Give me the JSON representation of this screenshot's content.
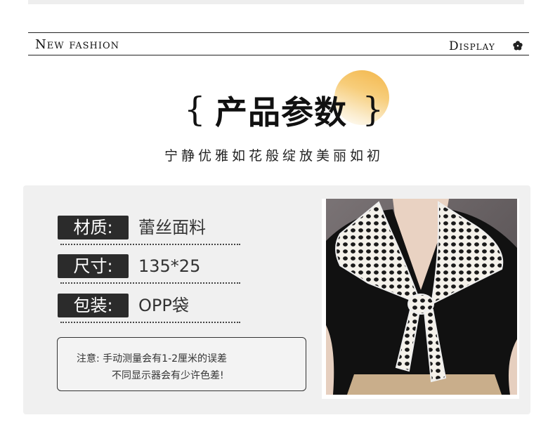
{
  "header": {
    "left_label": "New fashion",
    "right_label": "Display",
    "icon": "flower-icon"
  },
  "section": {
    "title_open": "{",
    "title": "产品参数",
    "title_close": "}",
    "subtitle": "宁静优雅如花般绽放美丽如初"
  },
  "specs": [
    {
      "label": "材质:",
      "value": "蕾丝面料"
    },
    {
      "label": "尺寸:",
      "value": "135*25"
    },
    {
      "label": "包装:",
      "value": "OPP袋"
    }
  ],
  "note": {
    "line1": "注意:  手动测量会有1-2厘米的误差",
    "line2": "不同显示器会有少许色差!"
  },
  "colors": {
    "accent": "#f3b64a",
    "label_bg": "#2b2b2b",
    "panel_bg": "#f0f0f0"
  }
}
